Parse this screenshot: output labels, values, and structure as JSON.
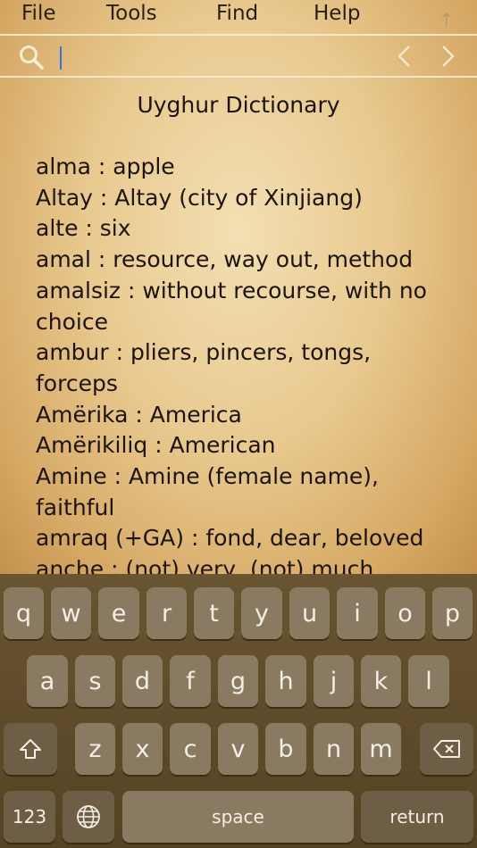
{
  "menu": {
    "file": "File",
    "tools": "Tools",
    "find": "Find",
    "help": "Help"
  },
  "search": {
    "value": "",
    "placeholder": ""
  },
  "dictionary": {
    "title": "Uyghur Dictionary",
    "entries": [
      "alma : apple",
      "Altay : Altay (city of Xinjiang)",
      "alte : six",
      "amal : resource, way out, method",
      "amalsiz : without recourse, with no choice",
      "ambur : pliers, pincers, tongs, forceps",
      "Amërika : America",
      "Amërikiliq : American",
      "Amine : Amine (female name), faithful",
      "amraq (+GA) : fond, dear, beloved",
      "anche : (not) very, (not) much"
    ]
  },
  "keyboard": {
    "row1": [
      "q",
      "w",
      "e",
      "r",
      "t",
      "y",
      "u",
      "i",
      "o",
      "p"
    ],
    "row2": [
      "a",
      "s",
      "d",
      "f",
      "g",
      "h",
      "j",
      "k",
      "l"
    ],
    "row3": [
      "z",
      "x",
      "c",
      "v",
      "b",
      "n",
      "m"
    ],
    "numbers_label": "123",
    "space_label": "space",
    "return_label": "return"
  },
  "colors": {
    "accent": "#3a6fe0",
    "parchment": "#e8c98f",
    "keyboard_bg": "#5f4b2b"
  }
}
